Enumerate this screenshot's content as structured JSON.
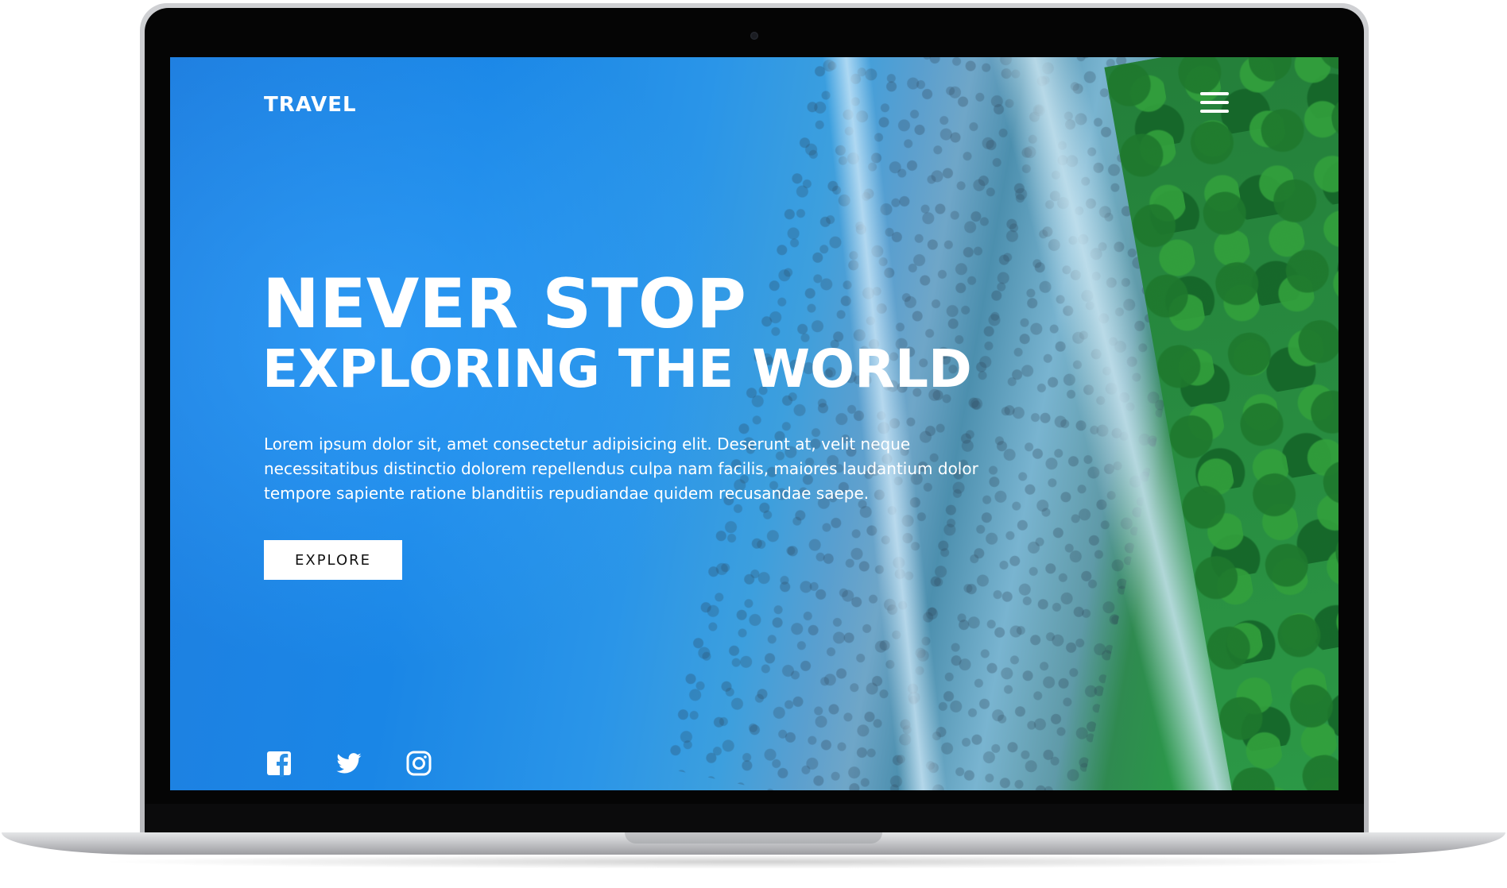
{
  "site": {
    "brand": "TRAVEL",
    "menu_icon": "hamburger-menu-icon"
  },
  "hero": {
    "title_line1": "NEVER STOP",
    "title_line2": "EXPLORING THE WORLD",
    "body": "Lorem ipsum dolor sit, amet consectetur adipisicing elit. Deserunt at, velit neque necessitatibus distinctio dolorem repellendus culpa nam facilis, maiores laudantium dolor tempore sapiente ratione blanditiis repudiandae quidem recusandae saepe.",
    "button_label": "EXPLORE"
  },
  "social": [
    {
      "icon": "facebook-icon"
    },
    {
      "icon": "twitter-icon"
    },
    {
      "icon": "instagram-icon"
    }
  ],
  "colors": {
    "text": "#ffffff",
    "button_bg": "#ffffff",
    "button_text": "#111111",
    "water": "#1f7fe0",
    "forest": "#2a9a48"
  }
}
